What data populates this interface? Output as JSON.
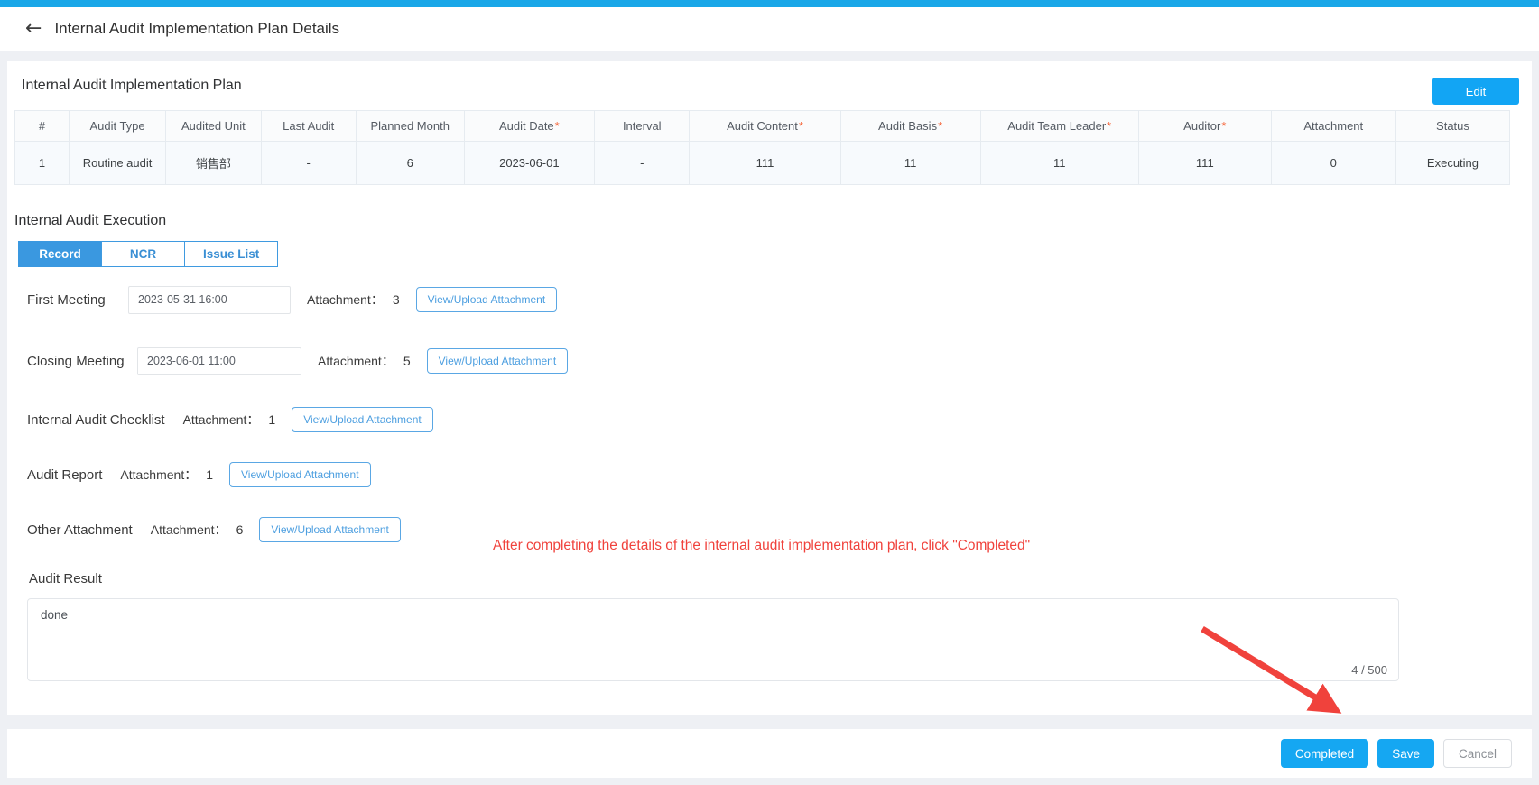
{
  "header": {
    "back_icon": "arrow-left-icon",
    "title": "Internal Audit Implementation Plan Details"
  },
  "plan_section": {
    "title": "Internal Audit Implementation Plan",
    "edit_label": "Edit",
    "columns": [
      {
        "label": "#",
        "required": false
      },
      {
        "label": "Audit Type",
        "required": false
      },
      {
        "label": "Audited Unit",
        "required": false
      },
      {
        "label": "Last Audit",
        "required": false
      },
      {
        "label": "Planned Month",
        "required": false
      },
      {
        "label": "Audit Date",
        "required": true
      },
      {
        "label": "Interval",
        "required": false
      },
      {
        "label": "Audit Content",
        "required": true
      },
      {
        "label": "Audit Basis",
        "required": true
      },
      {
        "label": "Audit Team Leader",
        "required": true
      },
      {
        "label": "Auditor",
        "required": true
      },
      {
        "label": "Attachment",
        "required": false
      },
      {
        "label": "Status",
        "required": false
      }
    ],
    "rows": [
      {
        "index": "1",
        "audit_type": "Routine audit",
        "audited_unit": "销售部",
        "last_audit": "-",
        "planned_month": "6",
        "audit_date": "2023-06-01",
        "interval": "-",
        "audit_content": "111",
        "audit_basis": "11",
        "audit_team_leader": "11",
        "auditor": "111",
        "attachment": "0",
        "status": "Executing"
      }
    ]
  },
  "execution_section": {
    "title": "Internal Audit Execution",
    "tabs": [
      {
        "label": "Record",
        "active": true
      },
      {
        "label": "NCR",
        "active": false
      },
      {
        "label": "Issue List",
        "active": false
      }
    ],
    "rows": [
      {
        "label": "First Meeting",
        "datetime": "2023-05-31 16:00",
        "attachment_label": "Attachment：",
        "attachment_count": "3",
        "button_label": "View/Upload Attachment"
      },
      {
        "label": "Closing Meeting",
        "datetime": "2023-06-01 11:00",
        "attachment_label": "Attachment：",
        "attachment_count": "5",
        "button_label": "View/Upload Attachment"
      },
      {
        "label": "Internal Audit Checklist",
        "datetime": null,
        "attachment_label": "Attachment：",
        "attachment_count": "1",
        "button_label": "View/Upload Attachment"
      },
      {
        "label": "Audit Report",
        "datetime": null,
        "attachment_label": "Attachment：",
        "attachment_count": "1",
        "button_label": "View/Upload Attachment"
      },
      {
        "label": "Other Attachment",
        "datetime": null,
        "attachment_label": "Attachment：",
        "attachment_count": "6",
        "button_label": "View/Upload Attachment"
      }
    ],
    "audit_result": {
      "label": "Audit Result",
      "value": "done",
      "char_count": "4 / 500"
    }
  },
  "annotation": {
    "text": "After completing the details of the internal audit implementation plan, click \"Completed\"",
    "color": "#f0423c",
    "arrow": "red-arrow-pointing-to-completed-button"
  },
  "footer": {
    "completed_label": "Completed",
    "save_label": "Save",
    "cancel_label": "Cancel"
  },
  "colors": {
    "accent": "#1aa7e8",
    "primary_button": "#15a7f2",
    "tab_active": "#3a98e0",
    "link": "#2a8ce0",
    "required_star": "#f5683d",
    "annotation": "#f0423c"
  }
}
